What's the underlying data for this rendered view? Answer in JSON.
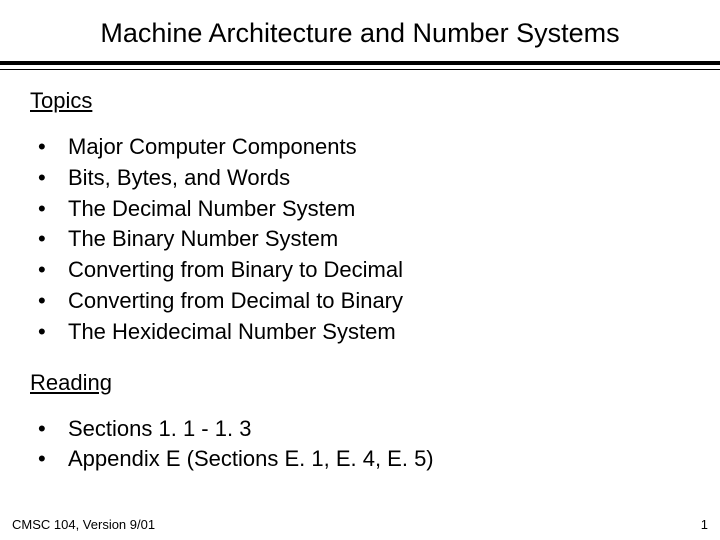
{
  "title": "Machine Architecture and Number Systems",
  "sections": {
    "topics": {
      "heading": "Topics",
      "items": [
        "Major Computer Components",
        "Bits, Bytes, and Words",
        "The Decimal Number System",
        "The Binary Number System",
        "Converting from Binary to Decimal",
        "Converting from Decimal to Binary",
        "The Hexidecimal Number System"
      ]
    },
    "reading": {
      "heading": "Reading",
      "items": [
        "Sections 1. 1 - 1. 3",
        "Appendix E (Sections E. 1, E. 4, E. 5)"
      ]
    }
  },
  "footer": {
    "course": "CMSC 104, Version 9/01",
    "page": "1"
  },
  "bullet": "•"
}
